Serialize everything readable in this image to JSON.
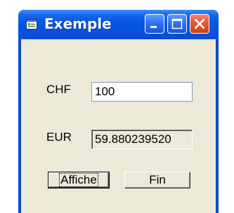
{
  "window": {
    "title": "Exemple",
    "title_icon": "app-window-icon",
    "controls": {
      "minimize_icon": "minimize-icon",
      "maximize_icon": "maximize-icon",
      "close_icon": "close-icon"
    }
  },
  "form": {
    "chf_label": "CHF",
    "chf_value": "100",
    "eur_label": "EUR",
    "eur_value": "59.880239520"
  },
  "buttons": {
    "affiche_label": "Affiche",
    "fin_label": "Fin"
  },
  "colors": {
    "titlebar": "#0656e4",
    "client_background": "#ece9d8",
    "close_button": "#e35a34"
  }
}
